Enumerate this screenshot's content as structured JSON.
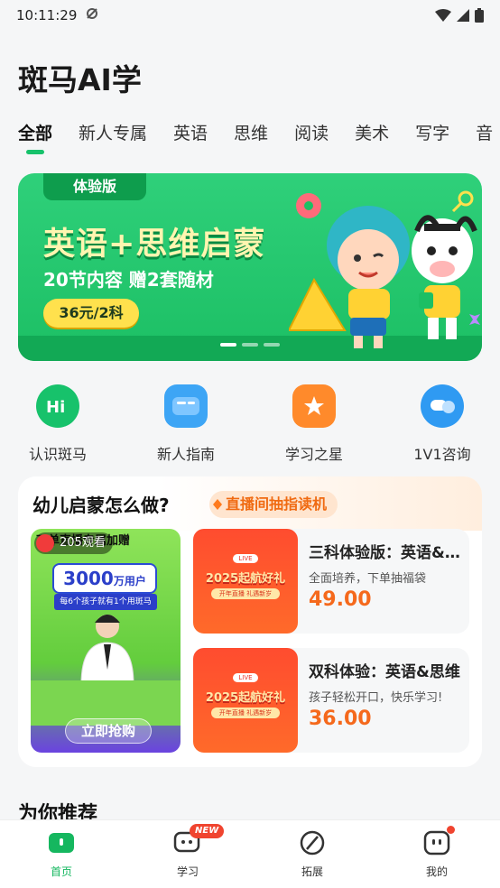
{
  "status_bar": {
    "time": "10:11:29"
  },
  "app": {
    "title": "斑马AI学"
  },
  "tabs": [
    {
      "label": "全部",
      "active": true
    },
    {
      "label": "新人专属"
    },
    {
      "label": "英语"
    },
    {
      "label": "思维"
    },
    {
      "label": "阅读"
    },
    {
      "label": "美术"
    },
    {
      "label": "写字"
    },
    {
      "label": "音"
    }
  ],
  "banner": {
    "tag": "体验版",
    "headline": "英语+思维启蒙",
    "sub": "20节内容 赠2套随材",
    "price_button": "36元/2科",
    "page_count": 3,
    "current_page": 1
  },
  "shortcuts": [
    {
      "label": "认识斑马",
      "icon": "hi-icon",
      "color": "#17c26b"
    },
    {
      "label": "新人指南",
      "icon": "guide-icon",
      "color": "#3da5f5"
    },
    {
      "label": "学习之星",
      "icon": "star-icon",
      "color": "#ff8a2b"
    },
    {
      "label": "1V1咨询",
      "icon": "chat-icon",
      "color": "#2f9af2"
    }
  ],
  "live_section": {
    "title": "幼儿启蒙怎么做?",
    "pill": "直播间抽指读机",
    "video": {
      "viewers": "205观看",
      "banner_text": "下单直播专属加赠",
      "users_big": "3000",
      "users_unit": "万用户",
      "slogan": "每6个孩子就有1个用斑马",
      "grab_button": "立即抢购"
    },
    "courses": [
      {
        "name": "三科体验版：英语&思维&阅读",
        "desc": "全面培养，下单抽福袋",
        "price": "49.00",
        "promo": "2025起航好礼",
        "promo_sub": "开年直播 礼遇新岁",
        "live_tag": "LIVE"
      },
      {
        "name": "双科体验：英语&思维",
        "desc": "孩子轻松开口，快乐学习!",
        "price": "36.00",
        "promo": "2025起航好礼",
        "promo_sub": "开年直播 礼遇新岁",
        "live_tag": "LIVE"
      }
    ]
  },
  "recommend": {
    "title": "为你推荐"
  },
  "bottom_nav": [
    {
      "label": "首页",
      "icon": "home-icon",
      "active": true
    },
    {
      "label": "学习",
      "icon": "study-icon",
      "badge": "NEW"
    },
    {
      "label": "拓展",
      "icon": "explore-icon"
    },
    {
      "label": "我的",
      "icon": "profile-icon",
      "dot": true
    }
  ],
  "colors": {
    "brand_green": "#17c26b",
    "price_orange": "#f5691c",
    "badge_red": "#f0442f"
  }
}
